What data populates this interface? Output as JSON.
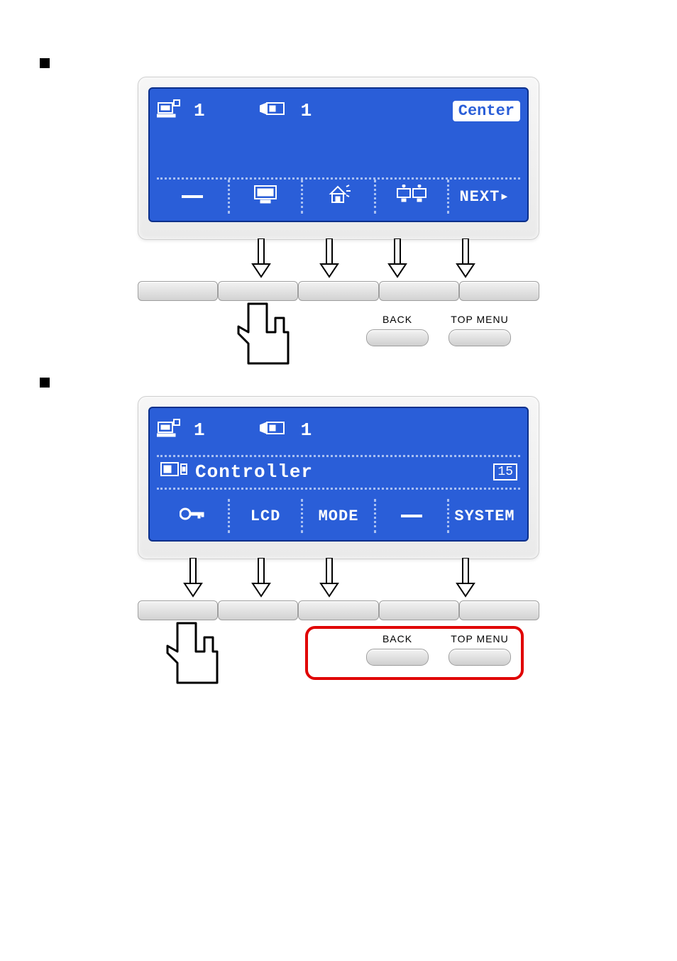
{
  "sections": {
    "step1": {
      "bullet_text": ""
    },
    "step2": {
      "bullet_text": ""
    }
  },
  "panel1": {
    "status": {
      "device_number": "1",
      "camera_number": "1",
      "badge": "Center"
    },
    "softkeys": {
      "s1": "",
      "s2": "",
      "s3": "",
      "s4": "",
      "s5": "NEXT▸"
    },
    "buttons": {
      "back": "BACK",
      "top_menu": "TOP MENU"
    }
  },
  "panel2": {
    "status": {
      "device_number": "1",
      "camera_number": "1"
    },
    "row_title": "Controller",
    "row_number": "15",
    "softkeys": {
      "s1": "",
      "s2": "LCD",
      "s3": "MODE",
      "s4": "",
      "s5": "SYSTEM"
    },
    "buttons": {
      "back": "BACK",
      "top_menu": "TOP MENU"
    }
  }
}
